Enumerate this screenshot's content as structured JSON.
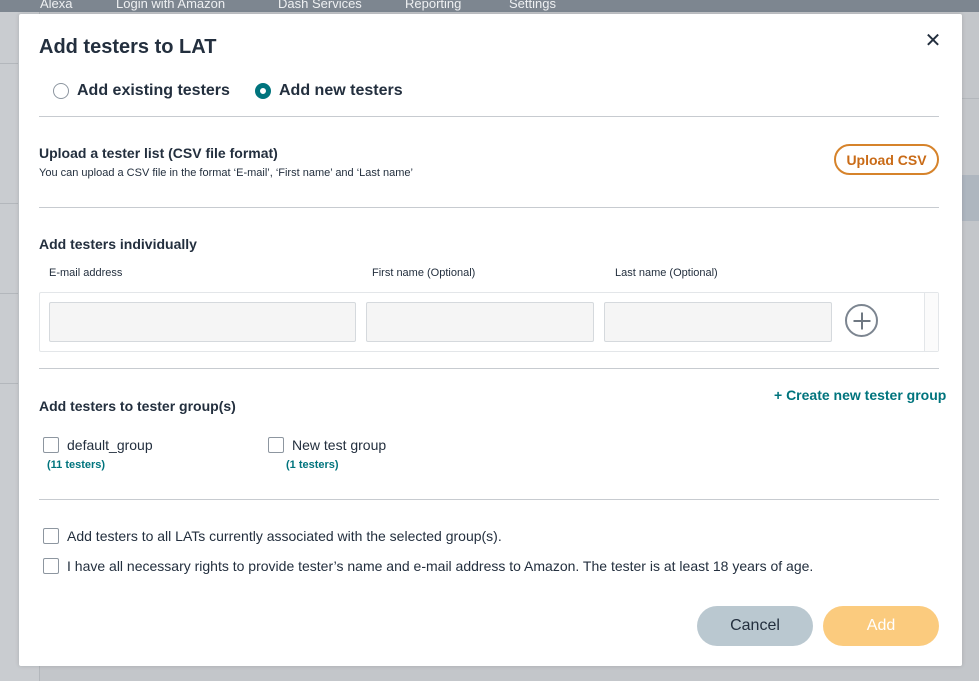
{
  "background_nav": [
    "Alexa",
    "Login with Amazon",
    "Dash Services",
    "Reporting",
    "Settings"
  ],
  "modal": {
    "title": "Add testers to LAT",
    "close_icon": "close-icon"
  },
  "mode": {
    "options": [
      {
        "label": "Add existing testers",
        "selected": false
      },
      {
        "label": "Add new testers",
        "selected": true
      }
    ]
  },
  "upload": {
    "title": "Upload a tester list (CSV file format)",
    "description": "You can upload a CSV file in the format ‘E-mail’, ‘First name’ and ‘Last name’",
    "button_label": "Upload CSV"
  },
  "individual": {
    "title": "Add testers individually",
    "columns": [
      "E-mail address",
      "First name (Optional)",
      "Last name (Optional)"
    ],
    "row": {
      "email": "",
      "first_name": "",
      "last_name": ""
    },
    "add_row_icon": "plus-circle-icon"
  },
  "groups": {
    "title": "Add testers to tester group(s)",
    "create_link": "+ Create new tester group",
    "items": [
      {
        "name": "default_group",
        "count": "(11 testers)",
        "checked": false
      },
      {
        "name": "New test group",
        "count": "(1 testers)",
        "checked": false
      }
    ]
  },
  "confirmations": [
    {
      "label": "Add testers to all LATs currently associated with the selected group(s).",
      "checked": false
    },
    {
      "label": "I have all necessary rights to provide tester’s name and e-mail address to Amazon. The tester is at least 18 years of age.",
      "checked": false
    }
  ],
  "actions": {
    "cancel_label": "Cancel",
    "add_label": "Add"
  },
  "colors": {
    "accent": "#00747d",
    "upload_outline": "#d6832b",
    "add_button_disabled": "#fbcb7e",
    "cancel_button": "#bac8d0"
  }
}
